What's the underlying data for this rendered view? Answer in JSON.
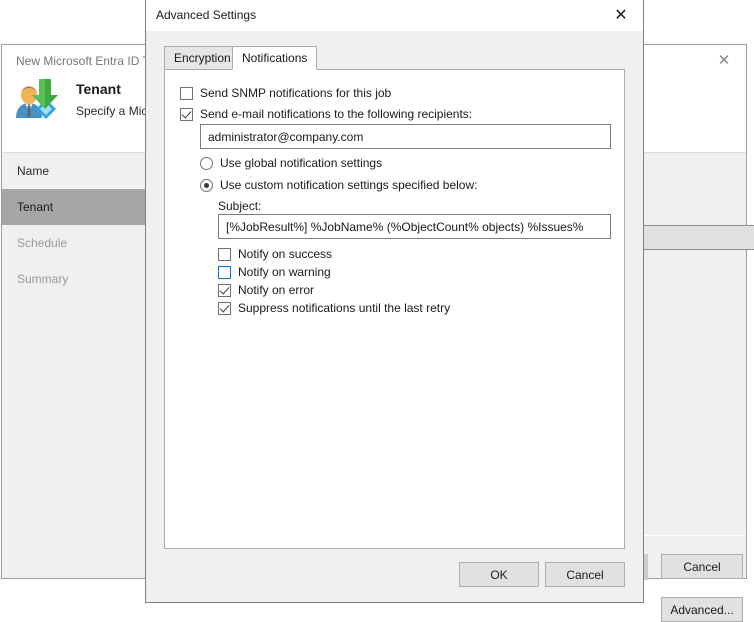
{
  "background_window": {
    "title": "New Microsoft Entra ID Te",
    "close_icon": "close-icon",
    "icon": "entra-id-tenant-backup-icon",
    "heading": "Tenant",
    "subheading": "Specify a Mic",
    "sidebar": {
      "items": [
        {
          "label": "Name",
          "state": "normal"
        },
        {
          "label": "Tenant",
          "state": "selected"
        },
        {
          "label": "Schedule",
          "state": "disabled"
        },
        {
          "label": "Summary",
          "state": "disabled"
        }
      ]
    },
    "combo": {
      "value": "",
      "chevron_icon": "chevron-down-icon"
    },
    "advanced_button": "Advanced...",
    "cancel_button": "Cancel"
  },
  "dialog": {
    "title": "Advanced Settings",
    "close_icon": "close-icon",
    "tabs": [
      {
        "label": "Encryption",
        "active": false
      },
      {
        "label": "Notifications",
        "active": true
      }
    ],
    "notifications": {
      "snmp": {
        "label": "Send SNMP notifications for this job",
        "checked": false
      },
      "email": {
        "label": "Send e-mail notifications to the following recipients:",
        "checked": true
      },
      "recipients": {
        "value": "administrator@company.com",
        "placeholder": ""
      },
      "radio_global": {
        "label": "Use global notification settings",
        "selected": false
      },
      "radio_custom": {
        "label": "Use custom notification settings specified below:",
        "selected": true
      },
      "subject_label": "Subject:",
      "subject": {
        "value": "[%JobResult%] %JobName% (%ObjectCount% objects) %Issues%",
        "placeholder": ""
      },
      "notify_success": {
        "label": "Notify on success",
        "checked": false,
        "hover": false
      },
      "notify_warning": {
        "label": "Notify on warning",
        "checked": false,
        "hover": true
      },
      "notify_error": {
        "label": "Notify on error",
        "checked": true,
        "hover": false
      },
      "suppress_retry": {
        "label": "Suppress notifications until the last retry",
        "checked": true,
        "hover": false
      }
    },
    "ok_button": "OK",
    "cancel_button": "Cancel"
  },
  "colors": {
    "accent": "#0078d7",
    "dialog_face": "#f0f0f0",
    "panel": "#ffffff",
    "selected_sidebar": "#a6a6a6"
  }
}
